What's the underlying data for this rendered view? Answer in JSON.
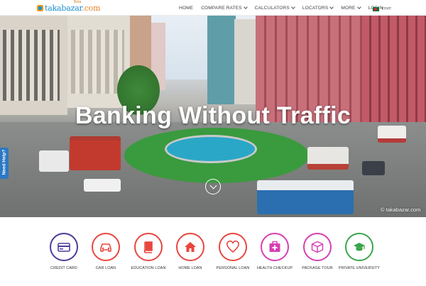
{
  "header": {
    "logo_text": "takabazar",
    "logo_suffix": ".com",
    "logo_badge": "Beta",
    "nav": [
      {
        "label": "HOME",
        "has_dropdown": false
      },
      {
        "label": "COMPARE RATES",
        "has_dropdown": true
      },
      {
        "label": "CALCULATORS",
        "has_dropdown": true
      },
      {
        "label": "LOCATORS",
        "has_dropdown": true
      },
      {
        "label": "MORE",
        "has_dropdown": true
      },
      {
        "label": "LOGIN",
        "has_dropdown": false
      }
    ],
    "language": "বাংলা"
  },
  "hero": {
    "title": "Banking Without Traffic",
    "watermark": "© takabazar.com",
    "help_tab": "Need Help?"
  },
  "services": [
    {
      "label": "CREDIT CARD",
      "icon": "credit-card-icon",
      "color": "#4a3b9e"
    },
    {
      "label": "CAR LOAN",
      "icon": "car-icon",
      "color": "#e8463f"
    },
    {
      "label": "EDUCATION LOAN",
      "icon": "book-icon",
      "color": "#e8463f"
    },
    {
      "label": "HOME LOAN",
      "icon": "home-icon",
      "color": "#e8463f"
    },
    {
      "label": "PERSONAL LOAN",
      "icon": "heart-icon",
      "color": "#e8463f"
    },
    {
      "label": "HEALTH CHECKUP",
      "icon": "medical-kit-icon",
      "color": "#d63fb4"
    },
    {
      "label": "PACKAGE TOUR",
      "icon": "package-icon",
      "color": "#d63fb4"
    },
    {
      "label": "PRIVATE UNIVERSITY",
      "icon": "graduation-cap-icon",
      "color": "#3aa54a"
    }
  ],
  "colors": {
    "brand_blue": "#1b8fd0",
    "brand_orange": "#e67e22",
    "help_tab": "#2b78c5"
  }
}
